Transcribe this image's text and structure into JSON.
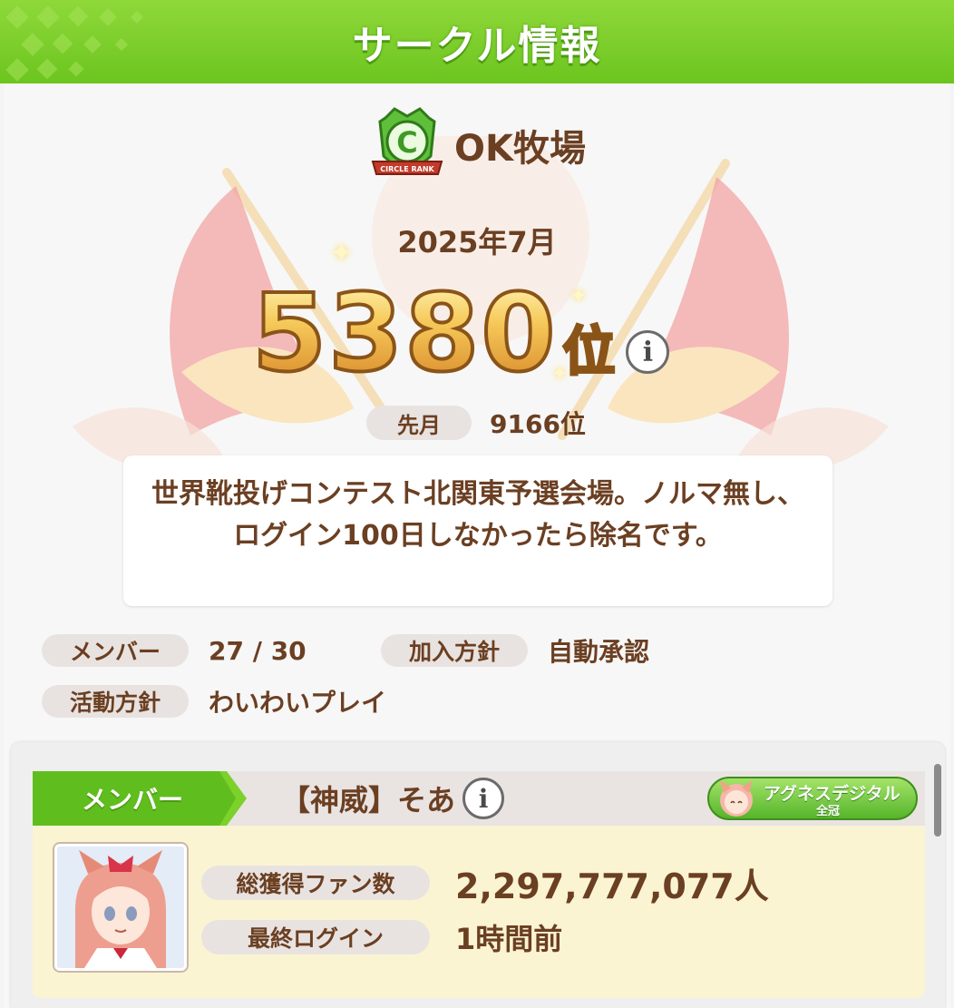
{
  "header": {
    "title": "サークル情報"
  },
  "circle": {
    "rank_badge_text": "CIRCLE RANK",
    "rank_letter": "C",
    "name": "OK牧場"
  },
  "ranking": {
    "month": "2025年7月",
    "rank": "5380",
    "rank_unit": "位",
    "info_icon": "i",
    "last_month_label": "先月",
    "last_month_value": "9166位"
  },
  "description": "世界靴投げコンテスト北関東予選会場。ノルマ無し、ログイン100日しなかったら除名です。",
  "stats": {
    "members_label": "メンバー",
    "members_value": "27 / 30",
    "join_policy_label": "加入方針",
    "join_policy_value": "自動承認",
    "activity_label": "活動方針",
    "activity_value": "わいわいプレイ"
  },
  "member_card": {
    "tag": "メンバー",
    "name": "【神威】そあ",
    "info_icon": "i",
    "title_badge_line1": "アグネスデジタル",
    "title_badge_line2": "全冠",
    "fans_label": "総獲得ファン数",
    "fans_value": "2,297,777,077人",
    "last_login_label": "最終ログイン",
    "last_login_value": "1時間前"
  },
  "colors": {
    "header_green": "#6cc51f",
    "text_brown": "#6b3f22",
    "rank_gold": "#e9a33a",
    "member_body": "#fbf4d2",
    "pill_bg": "#e8e3e1"
  }
}
